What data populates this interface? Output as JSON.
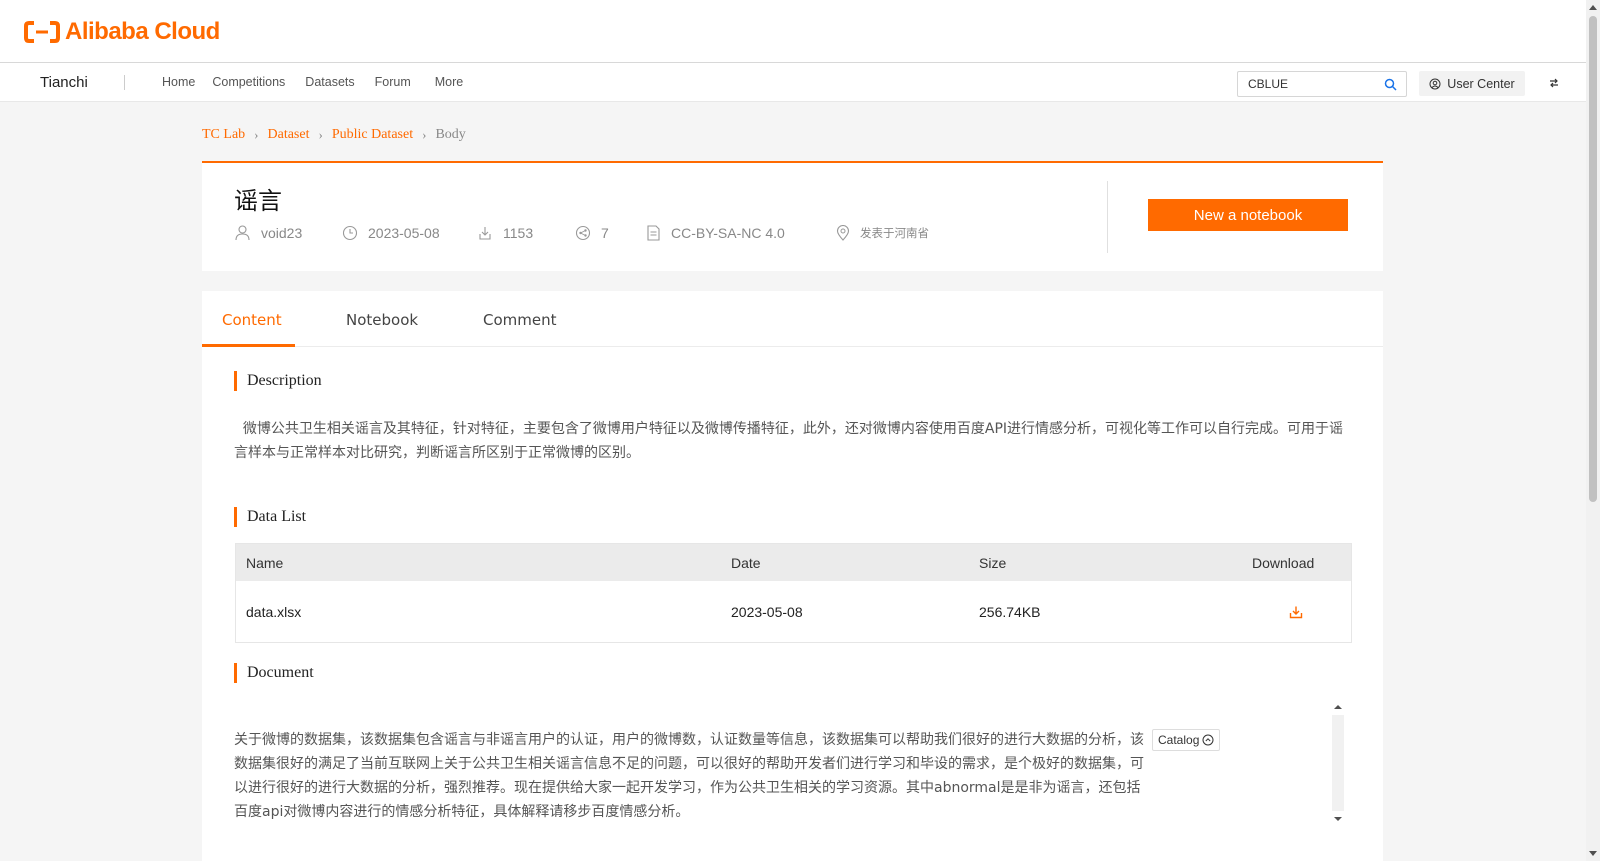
{
  "logo": {
    "text": "Alibaba Cloud",
    "icon": "alibaba-logo-icon"
  },
  "nav": {
    "brand": "Tianchi",
    "links": [
      "Home",
      "Competitions",
      "Datasets",
      "Forum",
      "More"
    ],
    "search_value": "CBLUE",
    "user_center": "User Center"
  },
  "breadcrumb": [
    "TC Lab",
    "Dataset",
    "Public Dataset",
    "Body"
  ],
  "dataset": {
    "title": "谣言",
    "author": "void23",
    "date": "2023-05-08",
    "downloads": "1153",
    "shares": "7",
    "license": "CC-BY-SA-NC 4.0",
    "location": "发表于河南省"
  },
  "actions": {
    "new_notebook": "New a notebook"
  },
  "tabs": [
    "Content",
    "Notebook",
    "Comment"
  ],
  "sections": {
    "description_title": "Description",
    "description": "微博公共卫生相关谣言及其特征，针对特征，主要包含了微博用户特征以及微博传播特征，此外，还对微博内容使用百度API进行情感分析，可视化等工作可以自行完成。可用于谣言样本与正常样本对比研究，判断谣言所区别于正常微博的区别。",
    "data_list_title": "Data List",
    "document_title": "Document",
    "document": "关于微博的数据集，该数据集包含谣言与非谣言用户的认证，用户的微博数，认证数量等信息，该数据集可以帮助我们很好的进行大数据的分析，该数据集很好的满足了当前互联网上关于公共卫生相关谣言信息不足的问题，可以很好的帮助开发者们进行学习和毕设的需求，是个极好的数据集，可以进行很好的进行大数据的分析，强烈推荐。现在提供给大家一起开发学习，作为公共卫生相关的学习资源。其中abnormal是是非为谣言，还包括百度api对微博内容进行的情感分析特征，具体解释请移步百度情感分析。",
    "catalog": "Catalog"
  },
  "table": {
    "headers": [
      "Name",
      "Date",
      "Size",
      "Download"
    ],
    "rows": [
      {
        "name": "data.xlsx",
        "date": "2023-05-08",
        "size": "256.74KB"
      }
    ]
  },
  "colors": {
    "accent": "#ff6a00"
  }
}
